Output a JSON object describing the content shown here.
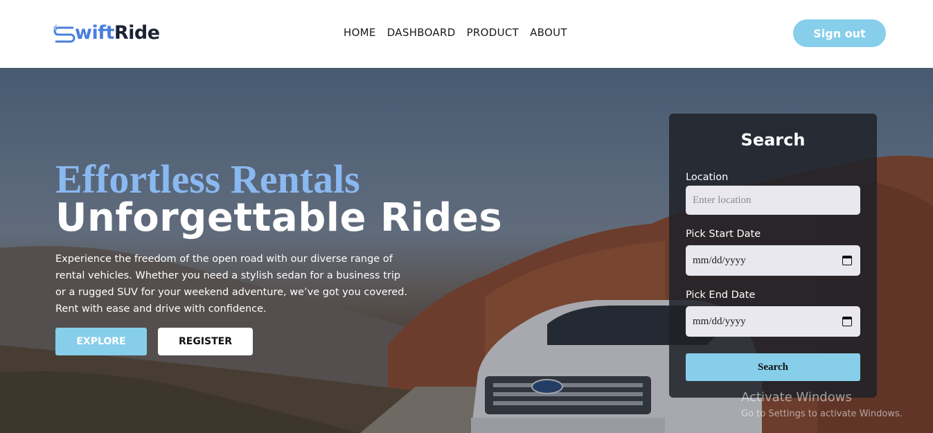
{
  "header": {
    "logo_letter": "S",
    "logo_part1": "wift",
    "logo_part2": "Ride",
    "nav": [
      "HOME",
      "DASHBOARD",
      "PRODUCT",
      "ABOUT"
    ],
    "signout_label": "Sign out"
  },
  "hero": {
    "headline_1": "Effortless Rentals",
    "headline_2": "Unforgettable Rides",
    "description": "Experience the freedom of the open road with our diverse range of rental vehicles. Whether you need a stylish sedan for a business trip or a rugged SUV for your weekend adventure, we’ve got you covered. Rent with ease and drive with confidence.",
    "explore_label": "EXPLORE",
    "register_label": "REGISTER"
  },
  "search": {
    "title": "Search",
    "location_label": "Location",
    "location_placeholder": "Enter location",
    "start_label": "Pick Start Date",
    "start_value": "mm/dd/yyyy",
    "end_label": "Pick End Date",
    "end_value": "mm/dd/yyyy",
    "button_label": "Search"
  },
  "watermark": {
    "title": "Activate Windows",
    "subtitle": "Go to Settings to activate Windows."
  },
  "colors": {
    "accent": "#87ceeb",
    "logo_blue": "#4a7fe0",
    "headline_blue": "#8ab8f0",
    "panel_bg": "#1e2128"
  }
}
